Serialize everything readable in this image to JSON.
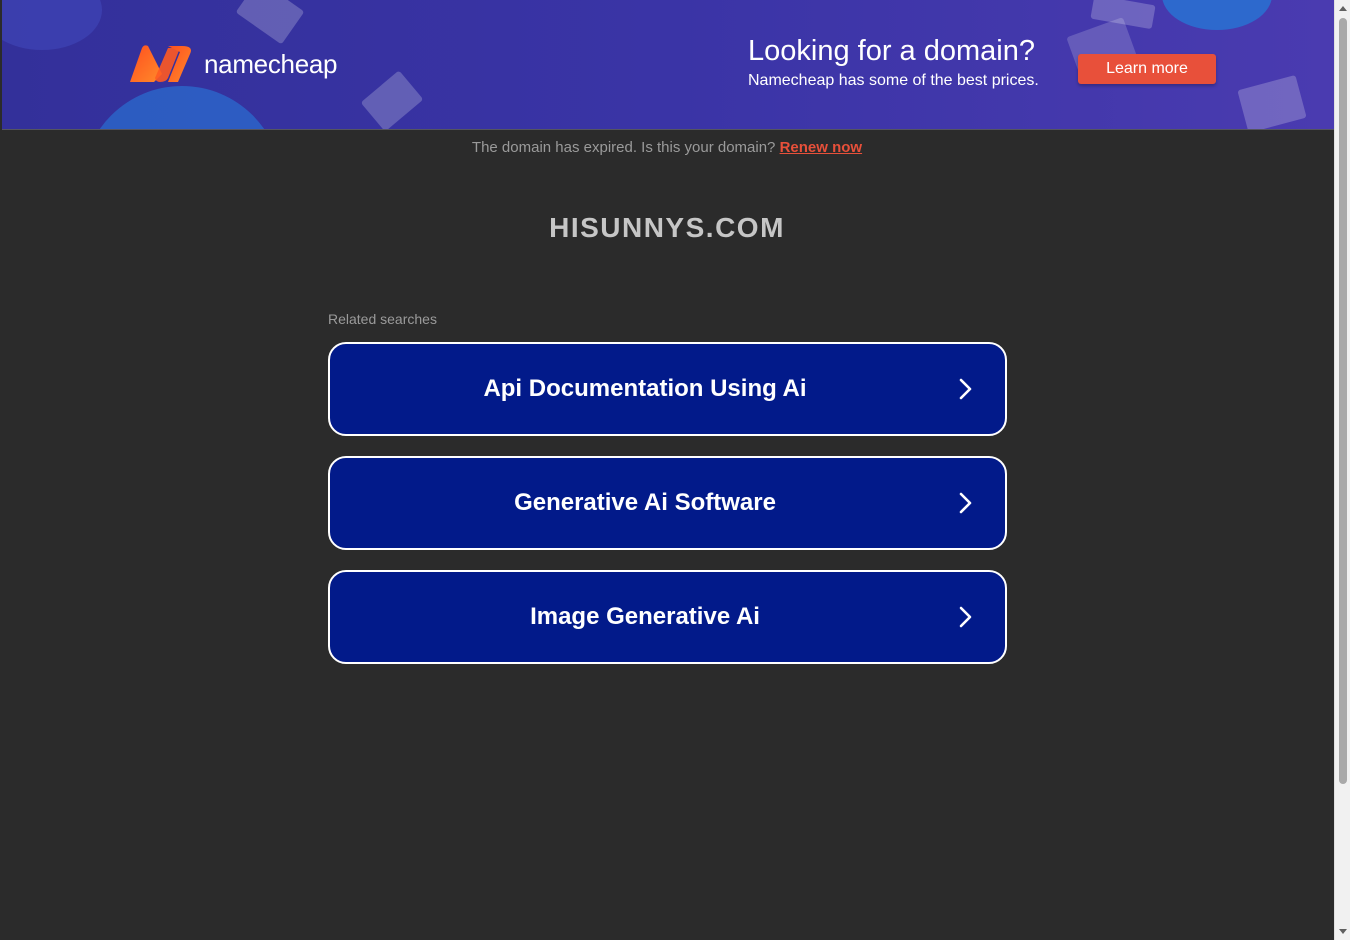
{
  "banner": {
    "logo_text": "namecheap",
    "promo_title": "Looking for a domain?",
    "promo_subtitle": "Namecheap has some of the best prices.",
    "cta_label": "Learn more",
    "colors": {
      "logo_orange": "#ff6a2a",
      "cta": "#e8503a",
      "background": "#3a34a6"
    }
  },
  "notice": {
    "text": "The domain has expired. Is this your domain?",
    "link_label": "Renew now"
  },
  "domain": "HISUNNYS.COM",
  "related": {
    "label": "Related searches",
    "items": [
      {
        "label": "Api Documentation Using Ai"
      },
      {
        "label": "Generative Ai Software"
      },
      {
        "label": "Image Generative Ai"
      }
    ]
  },
  "icons": {
    "chevron": "chevron-right-icon",
    "scroll_up": "arrow-up-icon",
    "scroll_down": "arrow-down-icon"
  }
}
